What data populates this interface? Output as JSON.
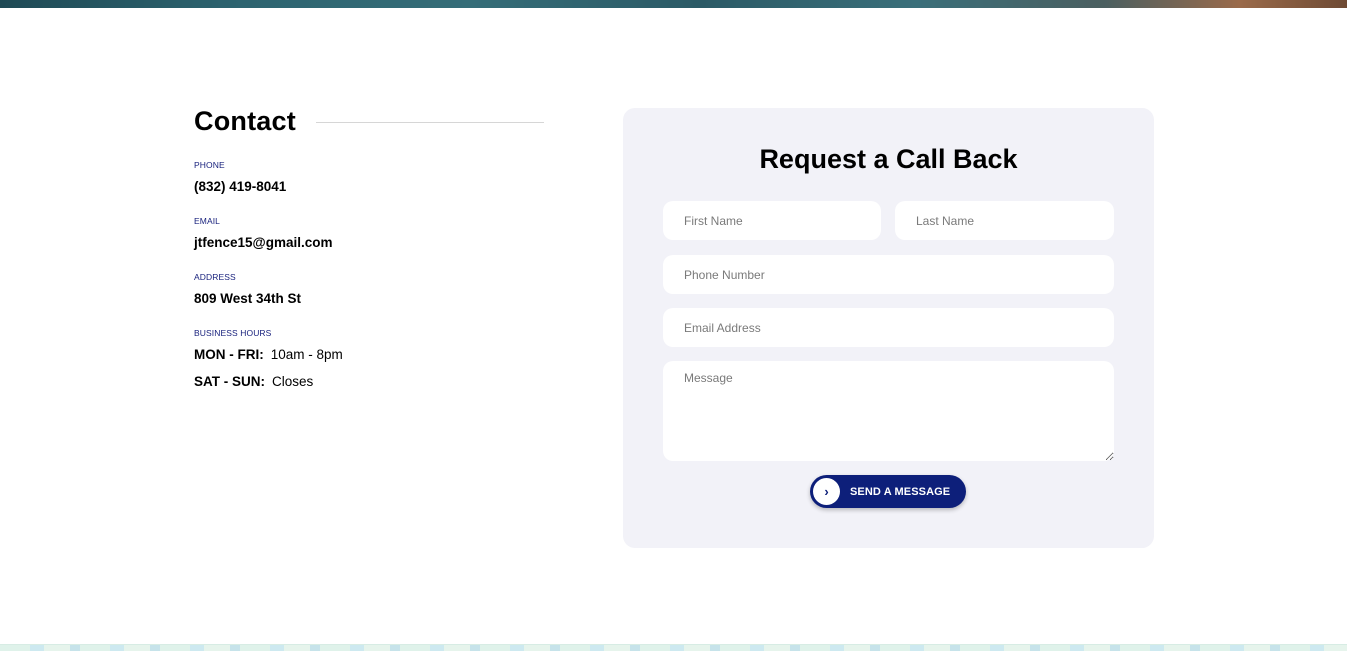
{
  "contact": {
    "title": "Contact",
    "phone_label": "PHONE",
    "phone_value": "(832) 419-8041",
    "email_label": "EMAIL",
    "email_value": "jtfence15@gmail.com",
    "address_label": "ADDRESS",
    "address_value": "809 West 34th St",
    "hours_label": "BUSINESS HOURS",
    "hours": [
      {
        "days": "MON - FRI:",
        "time": "10am - 8pm"
      },
      {
        "days": "SAT - SUN:",
        "time": "Closes"
      }
    ]
  },
  "form": {
    "title": "Request a Call Back",
    "first_name_placeholder": "First Name",
    "last_name_placeholder": "Last Name",
    "phone_placeholder": "Phone Number",
    "email_placeholder": "Email Address",
    "message_placeholder": "Message",
    "send_label": "SEND A MESSAGE",
    "send_icon": "chevron-right-icon"
  },
  "colors": {
    "accent": "#0d1f7a",
    "label": "#1a237e",
    "card_bg": "#f2f2f8"
  }
}
